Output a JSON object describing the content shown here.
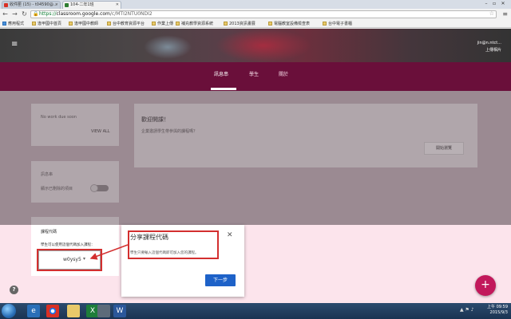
{
  "browser": {
    "tabs": [
      {
        "label": "收件匣 (15) - t04590@...",
        "favicon_color": "#d93025"
      },
      {
        "label": "104-二年1班",
        "favicon_color": "#2e7d32"
      }
    ],
    "url_prefix": "https://",
    "url_domain": "classroom.google.com",
    "url_path": "/c/MTI2NTU0NDI2",
    "bookmarks": [
      "應用程式",
      "逢甲國中首頁",
      "逢甲國中教師",
      "台中教育資源平台",
      "作業上傳",
      "補充教學資源系統",
      "2013資訊畫展",
      "電腦教室設備檢查表",
      "台中電子書櫃"
    ]
  },
  "banner": {
    "email": "jin@n.ntct...",
    "upload_label": "上傳相片"
  },
  "nav": {
    "tabs": [
      "訊息串",
      "學生",
      "關於"
    ]
  },
  "upcoming": {
    "no_work": "No work due soon",
    "view_all": "VIEW ALL"
  },
  "welcome": {
    "title": "歡迎開課！",
    "subtitle": "企業邀請學生帶參與的課程嗎？",
    "button": "開始瀏覽"
  },
  "stream_settings": {
    "title": "訊息串",
    "toggle_label": "顯示已刪除的項目"
  },
  "class_code": {
    "title": "課程代碼",
    "desc": "學生可以使用這個代碼加入課程：",
    "value": "w0ysy5"
  },
  "dialog": {
    "title": "分享課程代碼",
    "description": "學生只要輸入這個代碼即可加入您的課程。",
    "next_button": "下一步"
  },
  "fab_label": "+",
  "help_label": "?",
  "taskbar": {
    "time": "上午 09:59",
    "date": "2015/9/3"
  }
}
